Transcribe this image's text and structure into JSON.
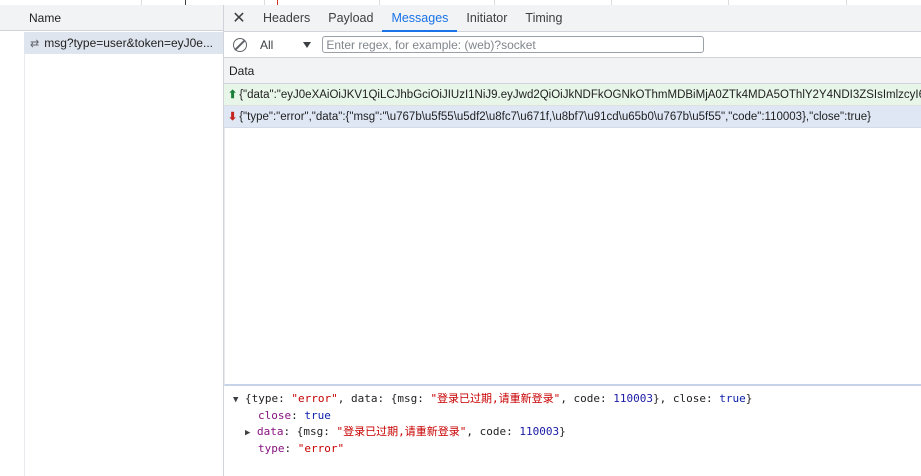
{
  "left": {
    "name_header": "Name",
    "request_name": "msg?type=user&token=eyJ0e...",
    "request_icon": "websocket-icon"
  },
  "tabs": [
    {
      "label": "Headers"
    },
    {
      "label": "Payload"
    },
    {
      "label": "Messages"
    },
    {
      "label": "Initiator"
    },
    {
      "label": "Timing"
    }
  ],
  "filter": {
    "type_value": "All",
    "placeholder": "Enter regex, for example: (web)?socket"
  },
  "data_header": "Data",
  "messages": [
    {
      "direction": "sent",
      "text": "{\"data\":\"eyJ0eXAiOiJKV1QiLCJhbGciOiJIUzI1NiJ9.eyJwd2QiOiJkNDFkOGNkOThmMDBiMjA0ZTk4MDA5OThlY2Y4NDI3ZSIsImlzcyI6I"
    },
    {
      "direction": "received",
      "text": "{\"type\":\"error\",\"data\":{\"msg\":\"\\u767b\\u5f55\\u5df2\\u8fc7\\u671f,\\u8bf7\\u91cd\\u65b0\\u767b\\u5f55\",\"code\":110003},\"close\":true}"
    }
  ],
  "detail": {
    "summary_prefix": "{type: ",
    "summary_type": "\"error\"",
    "summary_mid1": ", data: {msg: ",
    "summary_msg": "\"登录已过期,请重新登录\"",
    "summary_mid2": ", code: ",
    "summary_code": "110003",
    "summary_mid3": "}, close: ",
    "summary_close": "true",
    "summary_end": "}",
    "close_key": "close",
    "close_value": "true",
    "data_key": "data",
    "data_prefix": "{msg: ",
    "data_msg": "\"登录已过期,请重新登录\"",
    "data_mid": ", code: ",
    "data_code": "110003",
    "data_end": "}",
    "type_key": "type",
    "type_value": "\"error\""
  }
}
